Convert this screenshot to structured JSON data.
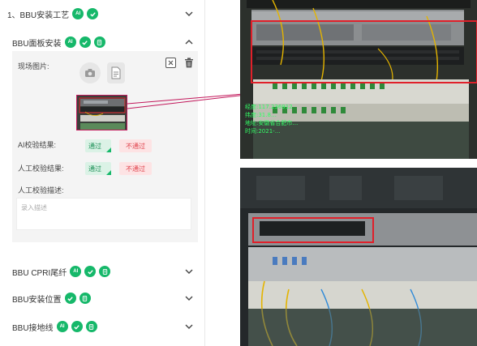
{
  "sections": {
    "process": {
      "title": "1、BBU安装工艺",
      "ai_badge": "AI"
    },
    "panel_install": {
      "title": "BBU面板安装",
      "ai_badge": "AI"
    },
    "cpri": {
      "title": "BBU CPRI尾纤",
      "ai_badge": "AI"
    },
    "position": {
      "title": "BBU安装位置"
    },
    "grounding": {
      "title": "BBU接地线",
      "ai_badge": "AI"
    }
  },
  "form": {
    "site_photo_label": "现场图片:",
    "ai_result_label": "AI校验结果:",
    "manual_result_label": "人工校验结果:",
    "manual_desc_label": "人工校验描述:",
    "pass_label": "通过",
    "fail_label": "不通过",
    "desc_placeholder": "录入描述"
  },
  "photo_overlay": {
    "line1": "经度:117.236912",
    "line2": "纬度:31.8…",
    "line3": "地址:安徽省合肥市…",
    "line4": "时间:2021-…"
  },
  "colors": {
    "green": "#16b86a",
    "red_box": "#e0202a",
    "thumb_border": "#c2185b"
  },
  "icons": [
    "chevron-down-icon",
    "chevron-up-icon",
    "check-icon",
    "doc-icon",
    "camera-icon",
    "file-icon",
    "close-icon",
    "trash-icon"
  ]
}
